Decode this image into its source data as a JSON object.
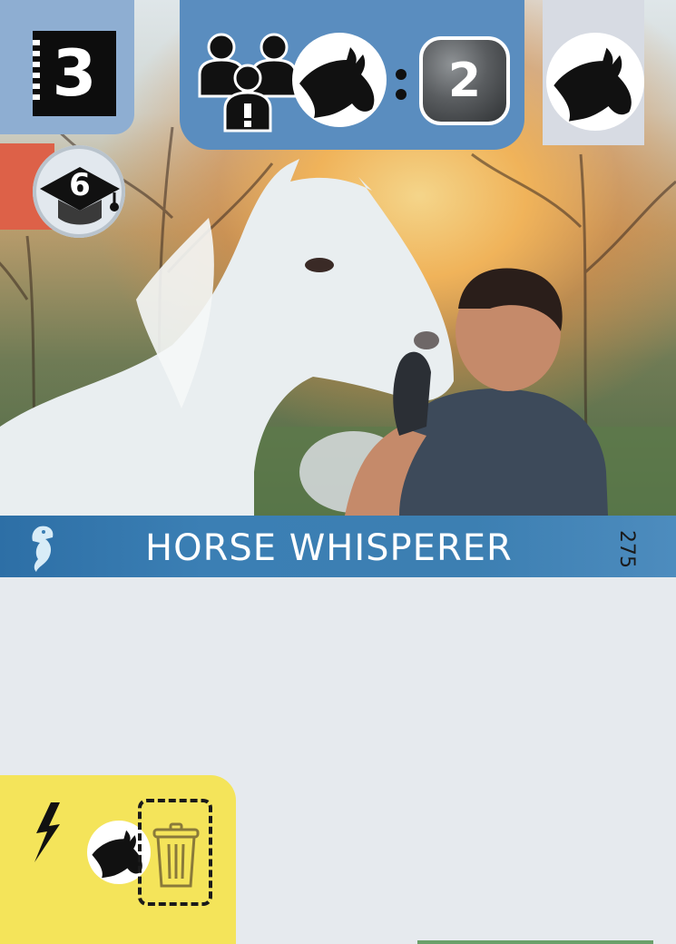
{
  "card": {
    "cost": "3",
    "education": "6",
    "ratio_value": "2",
    "title": "HORSE WHISPERER",
    "card_number": "275"
  },
  "icons": {
    "cost": "film-strip-cost-icon",
    "education": "graduation-cap-icon",
    "people": "people-alert-icon",
    "animal": "goat-head-icon",
    "category": "seahorse-icon",
    "ability": "lightning-bolt-icon",
    "discard": "trash-can-icon"
  },
  "colors": {
    "title_bar": "#3b7fb4",
    "top_panel": "#5a8dbf",
    "cost_corner": "#8eaed2",
    "education_strip": "#dd6148",
    "ability_box": "#f4e45a"
  }
}
